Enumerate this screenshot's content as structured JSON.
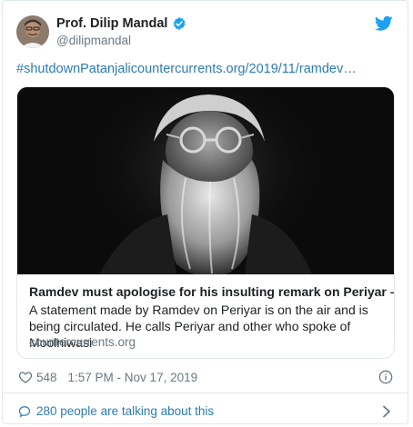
{
  "author": {
    "name": "Prof. Dilip Mandal",
    "handle": "@dilipmandal"
  },
  "tweet_text": "#shutdownPatanjalicountercurrents.org/2019/11/ramdev…",
  "card": {
    "title": "Ramdev must apologise for his insulting remark on Periyar – …",
    "description": "A statement made by Ramdev on Periyar is on the air and is being circulated. He calls Periyar and other who spoke of Moolniwasi",
    "domain": "countercurrents.org"
  },
  "stats": {
    "likes": "548",
    "timestamp": "1:57 PM - Nov 17, 2019"
  },
  "conversation": {
    "label": "280 people are talking about this"
  },
  "icons": {
    "verified": "verified-badge-icon",
    "brand": "twitter-bird-icon",
    "like": "heart-icon",
    "info": "info-icon",
    "conversation": "speech-bubble-icon",
    "chevron": "chevron-right-icon"
  },
  "colors": {
    "link": "#2b7bb9",
    "twitter_blue": "#1da1f2",
    "muted": "#697882",
    "border": "#e1e8ed"
  }
}
